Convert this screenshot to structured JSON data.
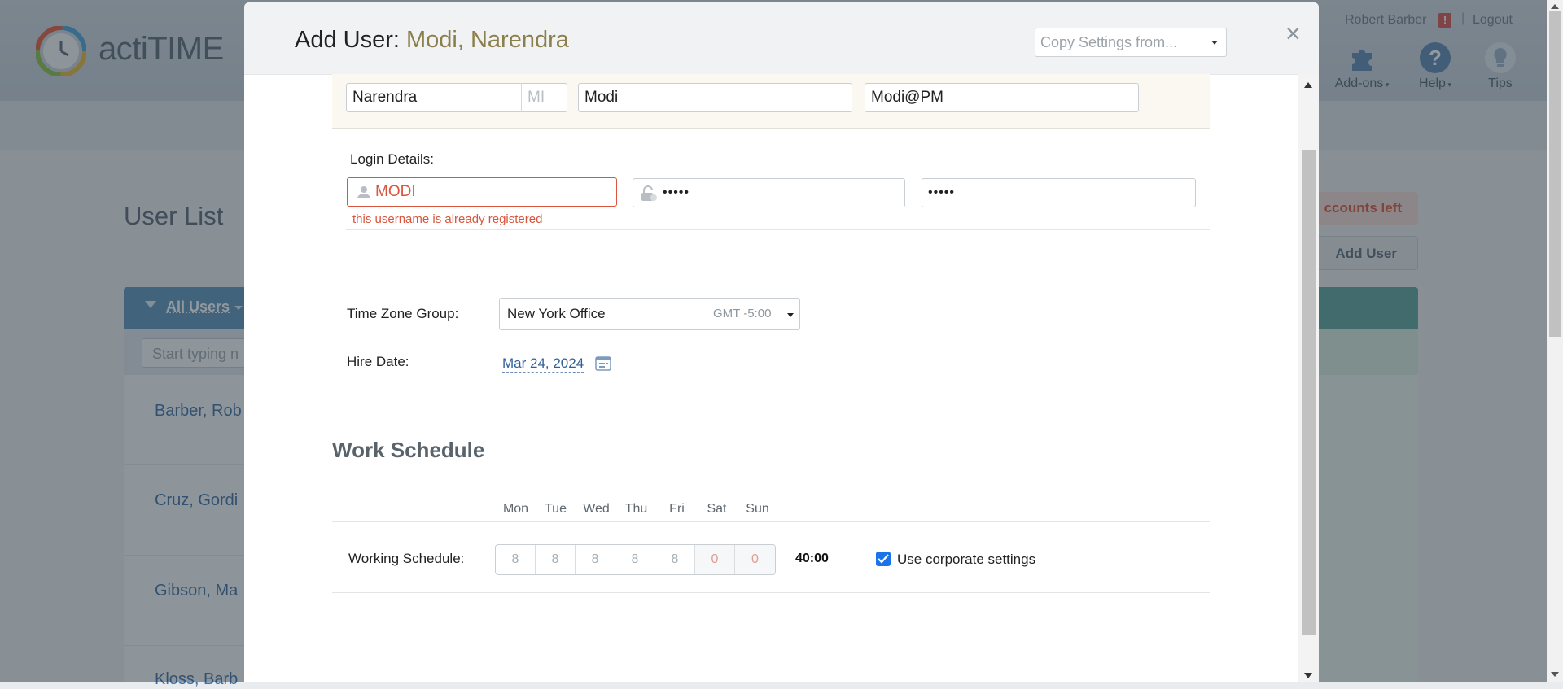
{
  "app": {
    "logo_text": "actiTIME",
    "user_name": "Robert Barber",
    "alert_badge": "!",
    "separator": "|",
    "logout_label": "Logout",
    "tools": [
      {
        "label": "Add-ons",
        "icon": "puzzle-icon"
      },
      {
        "label": "Help",
        "icon": "help-icon"
      },
      {
        "label": "Tips",
        "icon": "lightbulb-icon"
      }
    ]
  },
  "background": {
    "page_title": "User List",
    "accounts_badge": "ccounts left",
    "add_user_label": "Add User",
    "filter_label": "All Users",
    "search_placeholder": "Start typing n",
    "users": [
      "Barber, Rob",
      "Cruz, Gordi",
      "Gibson, Ma",
      "Kloss, Barb"
    ]
  },
  "modal": {
    "title_prefix": "Add User: ",
    "title_name": "Modi, Narendra",
    "copy_settings_placeholder": "Copy Settings from...",
    "close_symbol": "×",
    "name_fields": {
      "first_name": "Narendra",
      "middle_initial_placeholder": "MI",
      "last_name": "Modi",
      "email": "Modi@PM"
    },
    "login": {
      "label": "Login Details:",
      "username": "MODI",
      "password": "•••••",
      "password_confirm": "•••••",
      "error": "this username is already registered"
    },
    "time_zone": {
      "label": "Time Zone Group:",
      "value": "New York Office",
      "offset": "GMT -5:00"
    },
    "hire_date": {
      "label": "Hire Date:",
      "value": "Mar 24, 2024"
    },
    "work_schedule": {
      "title": "Work Schedule",
      "days": [
        "Mon",
        "Tue",
        "Wed",
        "Thu",
        "Fri",
        "Sat",
        "Sun"
      ],
      "row_label": "Working Schedule:",
      "hours": [
        "8",
        "8",
        "8",
        "8",
        "8",
        "0",
        "0"
      ],
      "total": "40:00",
      "use_corporate_label": "Use corporate settings",
      "use_corporate_checked": true
    }
  },
  "colors": {
    "accent_blue": "#1a73e8",
    "error_red": "#d9553d",
    "title_name_gold": "#8b7f4b",
    "list_header_blue": "#5b94bb"
  }
}
